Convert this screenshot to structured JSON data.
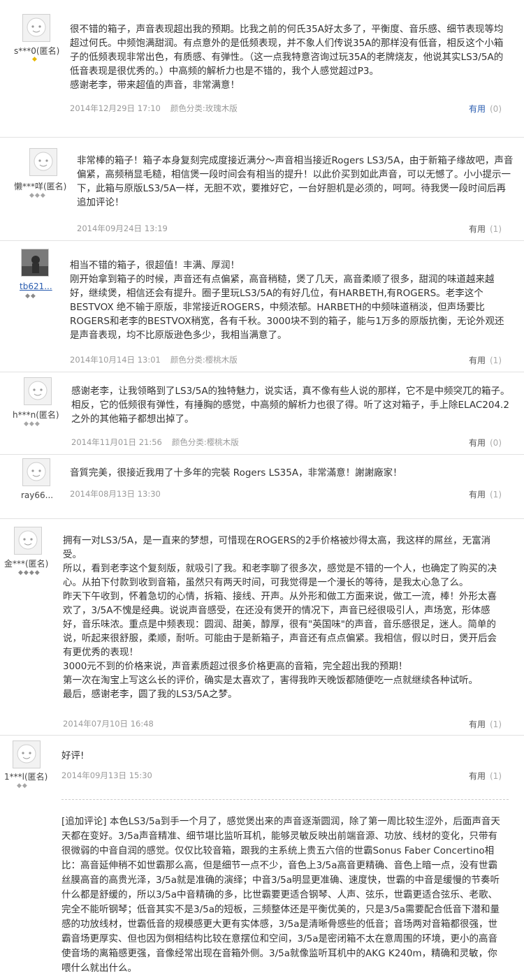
{
  "reviews": [
    {
      "user": "s***0(匿名)",
      "badge": "◆",
      "text": [
        "很不错的箱子，声音表现超出我的预期。比我之前的何氏35A好太多了，平衡度、音乐感、细节表现等均超过何氏。中频饱满甜润。有点意外的是低频表现，并不象人们传说35A的那样没有低音，相反这个小箱子的低频表现非常出色，有质感、有弹性。（这一点我特意咨询过玩35A的老牌烧友，他说其实LS3/5A的低音表现是很优秀的。）中高频的解析力也是不错的，我个人感觉超过P3。",
        "感谢老李，带来超值的声音，非常满意！"
      ],
      "date": "2014年12月29日 17:10",
      "variant": "颜色分类:玫瑰木版",
      "useful_label": "有用",
      "useful_count": "(0)"
    },
    {
      "user": "懒***咩(匿名)",
      "badge": "◆◆◆",
      "text": [
        "非常棒的箱子！箱子本身复刻完成度接近满分～声音相当接近Rogers LS3/5A，由于新箱子缘故吧，声音偏紧，高频稍显毛糙，相信煲一段时间会有相当的提升！以此价买到如此声音，可以无憾了。小小提示一下，此箱与原版LS3/5A一样，无胆不欢，要推好它，一台好胆机是必须的，呵呵。待我煲一段时间后再追加评论！"
      ],
      "date": "2014年09月24日 13:19",
      "variant": "",
      "useful_label": "有用",
      "useful_count": "(1)"
    },
    {
      "user": "tb621...",
      "badge": "◆◆",
      "text": [
        "相当不错的箱子，很超值！丰满、厚润！",
        "刚开始拿到箱子的时候，声音还有点偏紧，高音稍糙，煲了几天，高音柔顺了很多，甜润的味道越来越好，继续煲，相信还会有提升。圈子里玩LS3/5A的有好几位，有HARBETH,有ROGERS。老李这个BESTVOX 绝不输于原版，非常接近ROGERS，中频浓郁。HARBETH的中频味道稍淡，但声场要比ROGERS和老李的BESTVOX稍宽，各有千秋。3000块不到的箱子，能与1万多的原版抗衡，无论外观还是声音表现，均不比原版逊色多少，我相当满意了。"
      ],
      "date": "2014年10月14日 13:01",
      "variant": "颜色分类:樱桃木版",
      "useful_label": "有用",
      "useful_count": "(1)"
    },
    {
      "user": "h***n(匿名)",
      "badge": "◆◆◆",
      "text": [
        "感谢老李，让我领略到了LS3/5A的独特魅力，说实话，真不像有些人说的那样，它不是中频突兀的箱子。相反，它的低频很有弹性，有捶胸的感觉，中高频的解析力也很了得。听了这对箱子，手上除ELAC204.2之外的其他箱子都想出掉了。"
      ],
      "date": "2014年11月01日 21:56",
      "variant": "颜色分类:樱桃木版",
      "useful_label": "有用",
      "useful_count": "(0)"
    },
    {
      "user": "ray66...",
      "badge": "",
      "text": [
        "音質完美，很接近我用了十多年的完裝 Rogers LS35A，非常滿意！謝謝廠家！"
      ],
      "date": "2014年08月13日 13:30",
      "variant": "",
      "useful_label": "有用",
      "useful_count": "(1)"
    },
    {
      "user": "金***(匿名)",
      "badge": "◆◆◆◆",
      "text": [
        "拥有一对LS3/5A，是一直来的梦想，可惜现在ROGERS的2手价格被炒得太高，我这样的屌丝，无富消受。",
        "所以，看到老李这个复刻版，就吸引了我。和老李聊了很多次，感觉是不错的一个人，也确定了购买的决心。从拍下付款到收到音箱，虽然只有两天时间，可我觉得是一个漫长的等待，是我太心急了么。",
        "昨天下午收到，怀着急切的心情，拆箱、接线、开声。从外形和做工方面来说，做工一流，棒！外形太喜欢了，3/5A不愧是经典。说说声音感受，在还没有煲开的情况下，声音已经很吸引人，声场宽，形体感好，音乐味浓。重点是中频表现：圆润、甜美，醇厚，很有\"英国味\"的声音，音乐感很足，迷人。简单的说，听起来很舒服，柔顺，耐听。可能由于是新箱子，声音还有点点偏紧。我相信，假以时日，煲开后会有更优秀的表现！",
        "3000元不到的价格来说，声音素质超过很多价格更高的音箱，完全超出我的预期！",
        "第一次在淘宝上写这么长的评价，确实是太喜欢了，害得我昨天晚饭都随便吃一点就继续各种试听。",
        "最后，感谢老李，圆了我的LS3/5A之梦。"
      ],
      "date": "2014年07月10日 16:48",
      "variant": "",
      "useful_label": "有用",
      "useful_count": "(1)"
    },
    {
      "user": "1***l(匿名)",
      "badge": "◆◆",
      "text": [
        "好评!"
      ],
      "date": "2014年09月13日 15:30",
      "variant": "",
      "useful_label": "有用",
      "useful_count": "(1)",
      "followup": "[追加评论] 本色LS3/5a到手一个月了，感觉煲出来的声音逐渐圆润，除了第一周比较生涩外，后面声音天天都在变好。3/5a声音精准、细节堪比监听耳机，能够灵敏反映出前端音源、功放、线材的变化，只带有很微弱的中音自润的感觉。仅仅比较音箱，跟我的主系统上贵五六倍的世霸Sonus Faber Concertino相比：高音延伸稍不如世霸那么高，但是细节一点不少，音色上3/5a高音更精确、音色上暗一点，没有世霸丝膜高音的高贵光泽，3/5a就是准确的演绎；中音3/5a明显更准确、速度快，世霸的中音是缓慢的节奏听什么都是舒缓的，所以3/5a中音精确的多，比世霸要更适合钢琴、人声、弦乐，世霸更适合弦乐、老歌、完全不能听钢琴；低音其实不是3/5a的短板，三频整体还是平衡优美的，只是3/5a需要配合低音下潜和量感的功放线材，世霸低音的规模感更大更有实体感，3/5a是清晰骨感些的低音；音场两对音箱都很强，世霸音场更厚实、但也因为倒相结构比较在意摆位和空间，3/5a是密闭箱不太在意周围的环境，更小的高音使音场的离箱感更强，音像经常出现在音箱外侧。3/5a就像监听耳机中的AKG K240m，精确和灵敏，你喂什么就出什么。"
    }
  ]
}
